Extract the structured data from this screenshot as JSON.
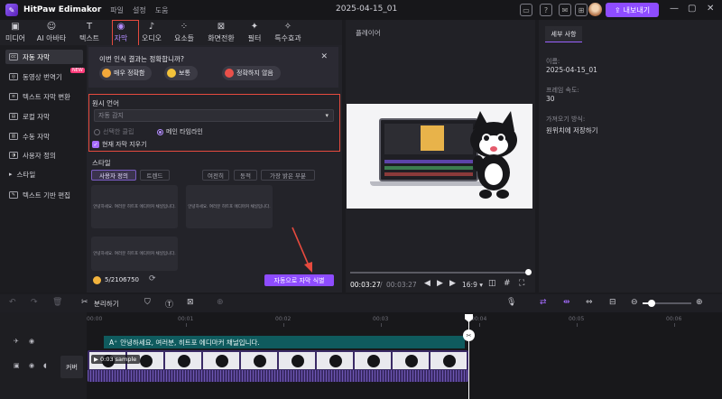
{
  "app": {
    "name": "HitPaw Edimakor",
    "menu": [
      "파일",
      "설정",
      "도움"
    ],
    "project_title": "2025-04-15_01",
    "export_label": "내보내기"
  },
  "toolbar": {
    "tools": [
      {
        "label": "미디어",
        "icon": "folder-icon"
      },
      {
        "label": "AI 아바타",
        "icon": "avatar-icon"
      },
      {
        "label": "텍스트",
        "icon": "text-icon"
      },
      {
        "label": "자막",
        "icon": "subtitle-icon",
        "active": true
      },
      {
        "label": "오디오",
        "icon": "music-icon"
      },
      {
        "label": "요소들",
        "icon": "elements-icon"
      },
      {
        "label": "화면전환",
        "icon": "transition-icon"
      },
      {
        "label": "필터",
        "icon": "filter-icon"
      },
      {
        "label": "특수효과",
        "icon": "effects-icon"
      }
    ]
  },
  "leftnav": {
    "items": [
      {
        "label": "자동 자막",
        "active": true
      },
      {
        "label": "동영상 번역기",
        "badge": "NEW"
      },
      {
        "label": "텍스트 자막 변환"
      },
      {
        "label": "로컬 자막"
      },
      {
        "label": "수동 자막"
      },
      {
        "label": "사용자 정의"
      },
      {
        "label": "스타일"
      },
      {
        "label": "텍스트 기반 편집"
      }
    ]
  },
  "feedback": {
    "question": "이번 인식 결과는 정확합니까?",
    "options": [
      "매우 정확함",
      "보통",
      "정확하지 않음"
    ]
  },
  "auto_subtitle": {
    "language_label": "원시 언어",
    "language_value": "자동 감지",
    "radio_selected_clips": "선택한 클립",
    "radio_main_timeline": "메인 타임라인",
    "clear_current_label": "현재 자막 지우기",
    "style_label": "스타일",
    "style_tabs": [
      "사용자 정의",
      "트렌드",
      "여전히",
      "동적",
      "가장 밝은 부분"
    ],
    "style_card_text": "안녕하세요. 여러분 히트포 에디마커 채널입니다.",
    "credits": "5/2106750",
    "generate_button": "자동으로 자막 식별"
  },
  "player": {
    "title": "플레이어",
    "current_time": "00:03:27",
    "total_time": "00:03:27",
    "aspect": "16:9"
  },
  "details": {
    "tab": "세부 사항",
    "name_label": "이름:",
    "name_value": "2025-04-15_01",
    "fps_label": "프레임 속도:",
    "fps_value": "30",
    "import_label": "가져오기 방식:",
    "import_value": "원위치에 저장하기"
  },
  "timeline": {
    "split_label": "분리하기",
    "ruler": [
      "00:00",
      "00:01",
      "00:02",
      "00:03",
      "00:04",
      "00:05",
      "00:06"
    ],
    "subtitle_clip_text": "안녕하세요, 여러분, 히트포 에디마커 채널입니다.",
    "video_clip_label": "0:03 sample",
    "cover_label": "커버"
  },
  "colors": {
    "accent": "#8e4cff",
    "highlight_box": "#e64a3e",
    "subtitle_clip": "#0f5b5e",
    "video_clip": "#3a2a66"
  }
}
